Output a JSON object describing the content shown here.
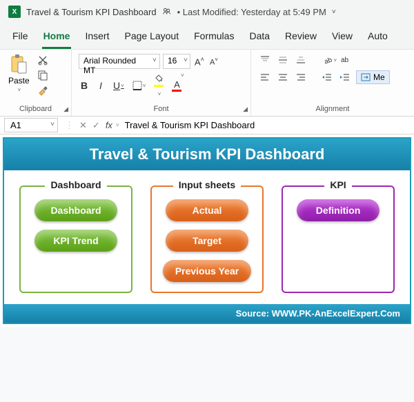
{
  "titlebar": {
    "doc_title": "Travel & Tourism KPI Dashboard",
    "last_modified": "• Last Modified: Yesterday at 5:49 PM"
  },
  "menu": {
    "file": "File",
    "home": "Home",
    "insert": "Insert",
    "page_layout": "Page Layout",
    "formulas": "Formulas",
    "data": "Data",
    "review": "Review",
    "view": "View",
    "auto": "Auto"
  },
  "ribbon": {
    "clipboard": {
      "label": "Clipboard",
      "paste": "Paste"
    },
    "font": {
      "label": "Font",
      "name": "Arial Rounded MT",
      "size": "16",
      "bold": "B",
      "italic": "I",
      "underline": "U",
      "inc": "A˄",
      "dec": "A˅"
    },
    "alignment": {
      "label": "Alignment",
      "wrap": "ab",
      "merge": "Me"
    }
  },
  "formula_bar": {
    "cell_ref": "A1",
    "fx": "fx",
    "value": "Travel & Tourism KPI Dashboard"
  },
  "dashboard": {
    "header": "Travel & Tourism KPI Dashboard",
    "cards": {
      "dashboard": {
        "title": "Dashboard",
        "items": [
          "Dashboard",
          "KPI Trend"
        ]
      },
      "input": {
        "title": "Input sheets",
        "items": [
          "Actual",
          "Target",
          "Previous Year"
        ]
      },
      "kpi": {
        "title": "KPI",
        "items": [
          "Definition"
        ]
      }
    },
    "footer": "Source: WWW.PK-AnExcelExpert.Com"
  }
}
